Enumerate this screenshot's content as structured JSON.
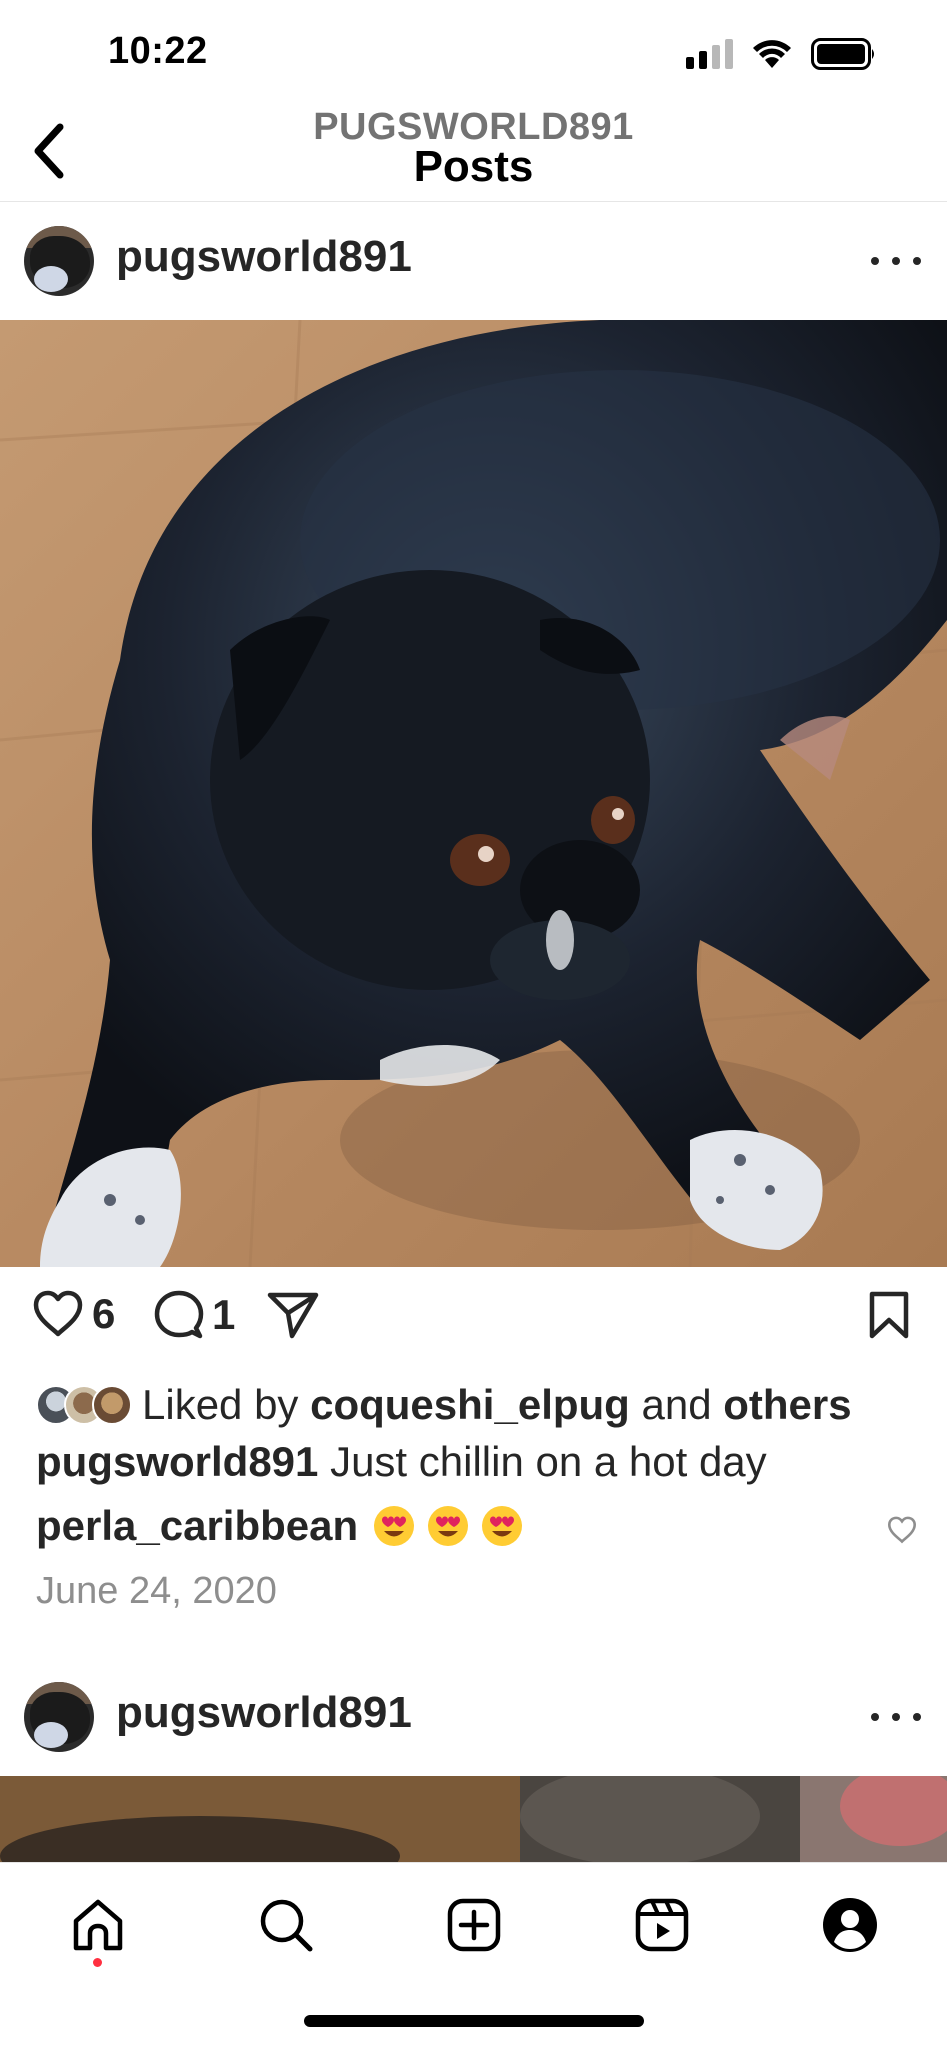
{
  "status_bar": {
    "time": "10:22"
  },
  "header": {
    "subtitle": "PUGSWORLD891",
    "title": "Posts"
  },
  "posts": [
    {
      "username": "pugsworld891",
      "likes_count": "6",
      "comments_count": "1",
      "liked_by_prefix": "Liked by",
      "liked_by_user": "coqueshi_elpug",
      "liked_by_and": "and",
      "liked_by_others": "others",
      "caption_user": "pugsworld891",
      "caption_text": "Just chillin on a hot day",
      "comment_user": "perla_caribbean",
      "comment_emoji": "heart-eyes x3",
      "date": "June 24, 2020"
    },
    {
      "username": "pugsworld891"
    }
  ],
  "bottom_nav": {
    "items": [
      "home-icon",
      "search-icon",
      "create-icon",
      "reels-icon",
      "profile-icon"
    ]
  },
  "colors": {
    "notification_dot": "#ff3040",
    "text": "#262626",
    "muted": "#8e8e8e"
  }
}
